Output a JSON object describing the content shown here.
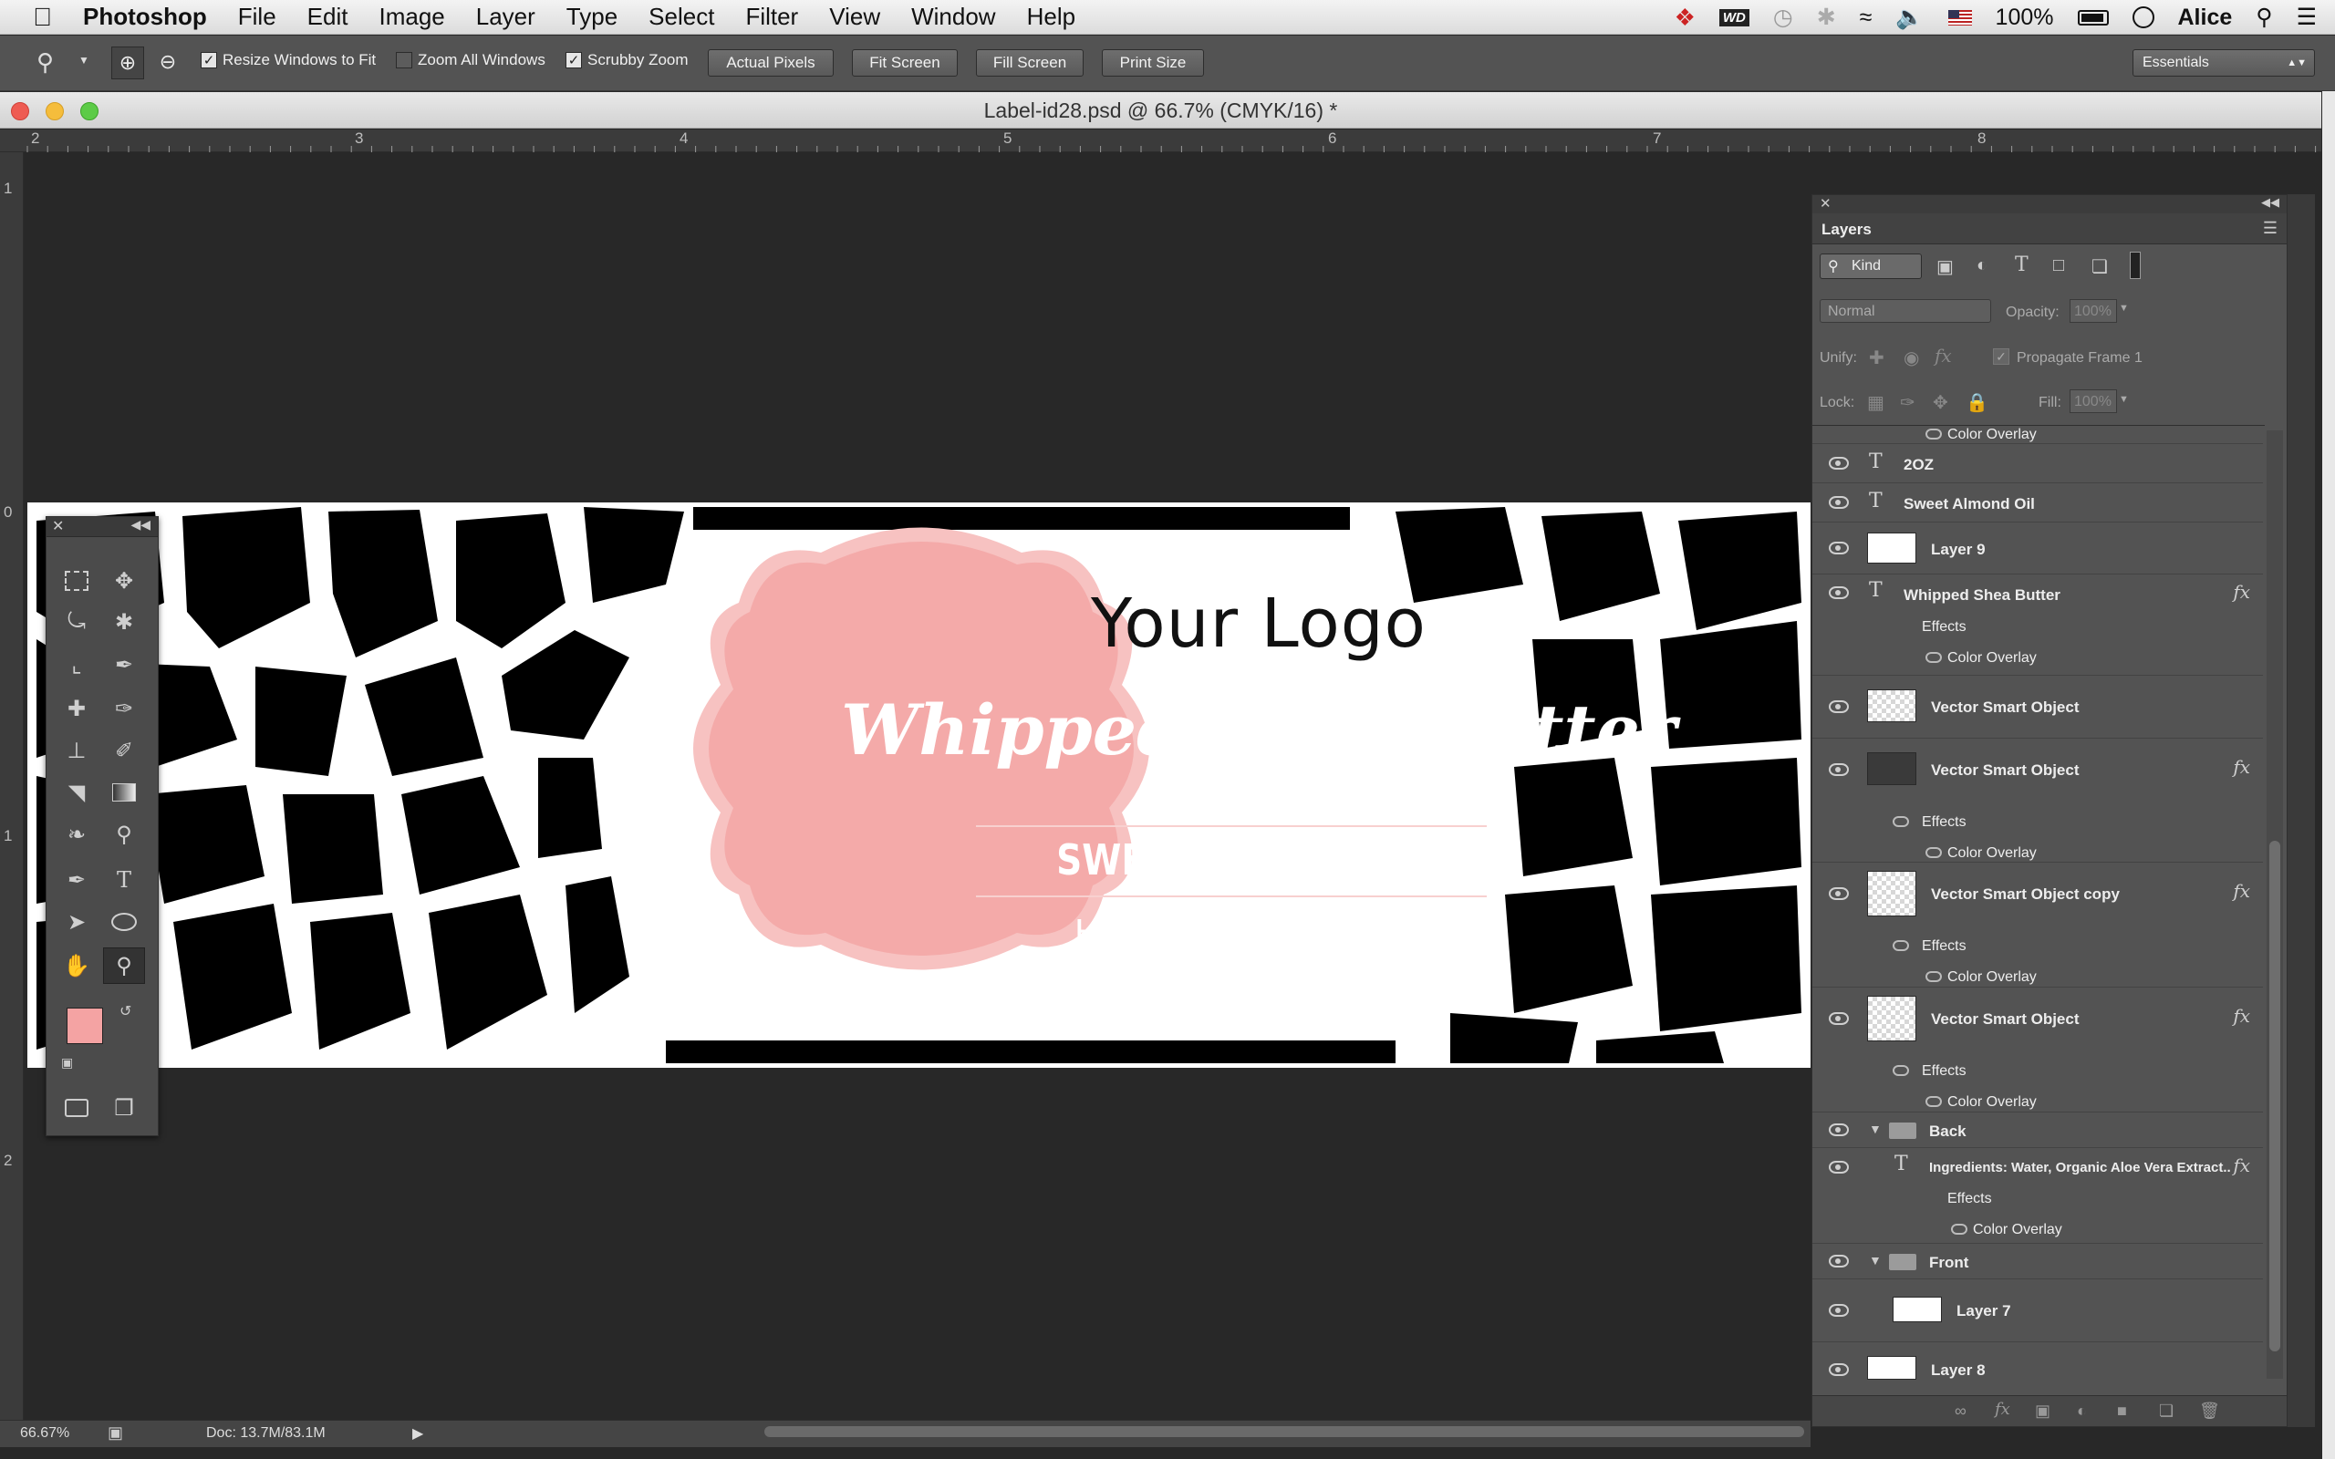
{
  "menubar": {
    "app_name": "Photoshop",
    "items": [
      "File",
      "Edit",
      "Image",
      "Layer",
      "Type",
      "Select",
      "Filter",
      "View",
      "Window",
      "Help"
    ],
    "battery": "100%",
    "user": "Alice"
  },
  "options": {
    "resize_windows": "Resize Windows to Fit",
    "zoom_all": "Zoom All Windows",
    "scrubby_zoom": "Scrubby Zoom",
    "actual_pixels": "Actual Pixels",
    "fit_screen": "Fit Screen",
    "fill_screen": "Fill Screen",
    "print_size": "Print Size",
    "workspace": "Essentials"
  },
  "document": {
    "title": "Label-id28.psd @ 66.7% (CMYK/16) *"
  },
  "ruler": {
    "h_marks": [
      "2",
      "3",
      "4",
      "5",
      "6",
      "7",
      "8"
    ],
    "v_marks": [
      "1",
      "0",
      "1",
      "2"
    ]
  },
  "label": {
    "logo": "Your Logo",
    "product": "Whipped Shea Butter",
    "oil": "SWEET ALMOND OIL",
    "tagline": "Hand made with love",
    "size": "2OZ",
    "badge_color": "#f4aaa9",
    "badge_border": "#f7c2c1"
  },
  "toolbox": {
    "fg_color": "#f4a3a3",
    "bg_color": "#ffffff"
  },
  "layers_panel": {
    "title": "Layers",
    "filter_kind": "Kind",
    "blend_mode": "Normal",
    "opacity_label": "Opacity:",
    "opacity_value": "100%",
    "unify_label": "Unify:",
    "propagate": "Propagate Frame 1",
    "lock_label": "Lock:",
    "fill_label": "Fill:",
    "fill_value": "100%",
    "top_effect": "Color Overlay",
    "rows": {
      "r1": "2OZ",
      "r2": "Sweet Almond Oil",
      "r3": "Layer 9",
      "r4": "Whipped Shea Butter",
      "r4_effects": "Effects",
      "r4_overlay": "Color Overlay",
      "r5": "Vector Smart Object",
      "r6": "Vector Smart Object",
      "r6_effects": "Effects",
      "r6_overlay": "Color Overlay",
      "r7": "Vector Smart Object copy",
      "r7_effects": "Effects",
      "r7_overlay": "Color Overlay",
      "r8": "Vector Smart Object",
      "r8_effects": "Effects",
      "r8_overlay": "Color Overlay",
      "r9": "Back",
      "r10": "Ingredients: Water, Organic Aloe Vera Extract...",
      "r10_effects": "Effects",
      "r10_overlay": "Color Overlay",
      "r11": "Front",
      "r12": "Layer 7",
      "r13": "Layer 8"
    }
  },
  "status": {
    "zoom": "66.67%",
    "doc": "Doc: 13.7M/83.1M"
  }
}
